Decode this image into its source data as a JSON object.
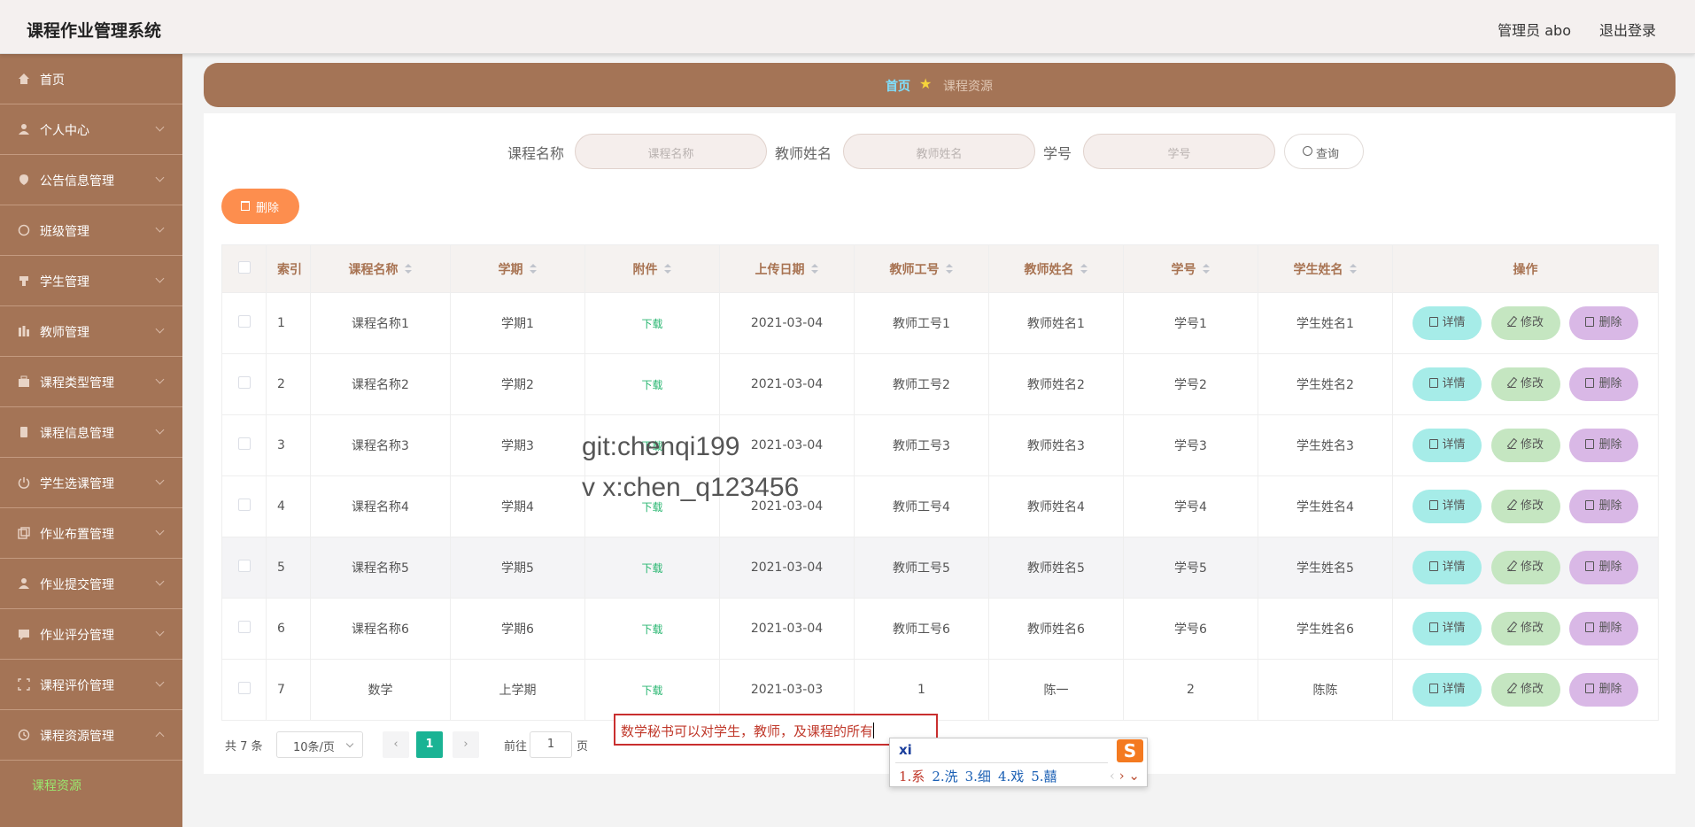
{
  "header": {
    "app_title": "课程作业管理系统",
    "user": "管理员 abo",
    "logout": "退出登录"
  },
  "sidebar": {
    "items": [
      {
        "label": "首页",
        "icon": "home-icon"
      },
      {
        "label": "个人中心",
        "icon": "user-icon"
      },
      {
        "label": "公告信息管理",
        "icon": "notice-icon"
      },
      {
        "label": "班级管理",
        "icon": "class-icon"
      },
      {
        "label": "学生管理",
        "icon": "student-icon"
      },
      {
        "label": "教师管理",
        "icon": "teacher-icon"
      },
      {
        "label": "课程类型管理",
        "icon": "category-icon"
      },
      {
        "label": "课程信息管理",
        "icon": "course-icon"
      },
      {
        "label": "学生选课管理",
        "icon": "select-icon"
      },
      {
        "label": "作业布置管理",
        "icon": "assign-icon"
      },
      {
        "label": "作业提交管理",
        "icon": "submit-icon"
      },
      {
        "label": "作业评分管理",
        "icon": "score-icon"
      },
      {
        "label": "课程评价管理",
        "icon": "review-icon"
      },
      {
        "label": "课程资源管理",
        "icon": "resource-icon"
      }
    ],
    "sub_item": "课程资源"
  },
  "breadcrumb": {
    "home": "首页",
    "current": "课程资源"
  },
  "search": {
    "course_label": "课程名称",
    "course_placeholder": "课程名称",
    "teacher_label": "教师姓名",
    "teacher_placeholder": "教师姓名",
    "student_label": "学号",
    "student_placeholder": "学号",
    "button": "查询"
  },
  "bulk_delete": "删除",
  "table": {
    "headers": [
      "索引",
      "课程名称",
      "学期",
      "附件",
      "上传日期",
      "教师工号",
      "教师姓名",
      "学号",
      "学生姓名",
      "操作"
    ],
    "download_label": "下载",
    "actions": {
      "detail": "详情",
      "edit": "修改",
      "delete": "删除"
    },
    "rows": [
      {
        "index": "1",
        "course": "课程名称1",
        "term": "学期1",
        "date": "2021-03-04",
        "teacher_id": "教师工号1",
        "teacher": "教师姓名1",
        "student_id": "学号1",
        "student": "学生姓名1"
      },
      {
        "index": "2",
        "course": "课程名称2",
        "term": "学期2",
        "date": "2021-03-04",
        "teacher_id": "教师工号2",
        "teacher": "教师姓名2",
        "student_id": "学号2",
        "student": "学生姓名2"
      },
      {
        "index": "3",
        "course": "课程名称3",
        "term": "学期3",
        "date": "2021-03-04",
        "teacher_id": "教师工号3",
        "teacher": "教师姓名3",
        "student_id": "学号3",
        "student": "学生姓名3"
      },
      {
        "index": "4",
        "course": "课程名称4",
        "term": "学期4",
        "date": "2021-03-04",
        "teacher_id": "教师工号4",
        "teacher": "教师姓名4",
        "student_id": "学号4",
        "student": "学生姓名4"
      },
      {
        "index": "5",
        "course": "课程名称5",
        "term": "学期5",
        "date": "2021-03-04",
        "teacher_id": "教师工号5",
        "teacher": "教师姓名5",
        "student_id": "学号5",
        "student": "学生姓名5"
      },
      {
        "index": "6",
        "course": "课程名称6",
        "term": "学期6",
        "date": "2021-03-04",
        "teacher_id": "教师工号6",
        "teacher": "教师姓名6",
        "student_id": "学号6",
        "student": "学生姓名6"
      },
      {
        "index": "7",
        "course": "数学",
        "term": "上学期",
        "date": "2021-03-03",
        "teacher_id": "1",
        "teacher": "陈一",
        "student_id": "2",
        "student": "陈陈"
      }
    ]
  },
  "pagination": {
    "total": "共 7 条",
    "page_size": "10条/页",
    "prev": "‹",
    "current_page": "1",
    "next": "›",
    "goto_label": "前往",
    "goto_value": "1",
    "goto_unit": "页"
  },
  "watermark": {
    "line1": "git:chenqi199",
    "line2": "v x:chen_q123456"
  },
  "overlay_input": {
    "text": "数学秘书可以对学生，教师，及课程的所有"
  },
  "ime": {
    "pinyin": "xi",
    "logo": "S",
    "candidates": [
      "1.系",
      "2.洗",
      "3.细",
      "4.戏",
      "5.囍"
    ],
    "nav_prev": "‹",
    "nav_next": "›",
    "nav_more": "⌄"
  },
  "colors": {
    "sidebar": "#a47456",
    "accent_green": "#1ab394",
    "delete_orange": "#fd8e4e"
  }
}
